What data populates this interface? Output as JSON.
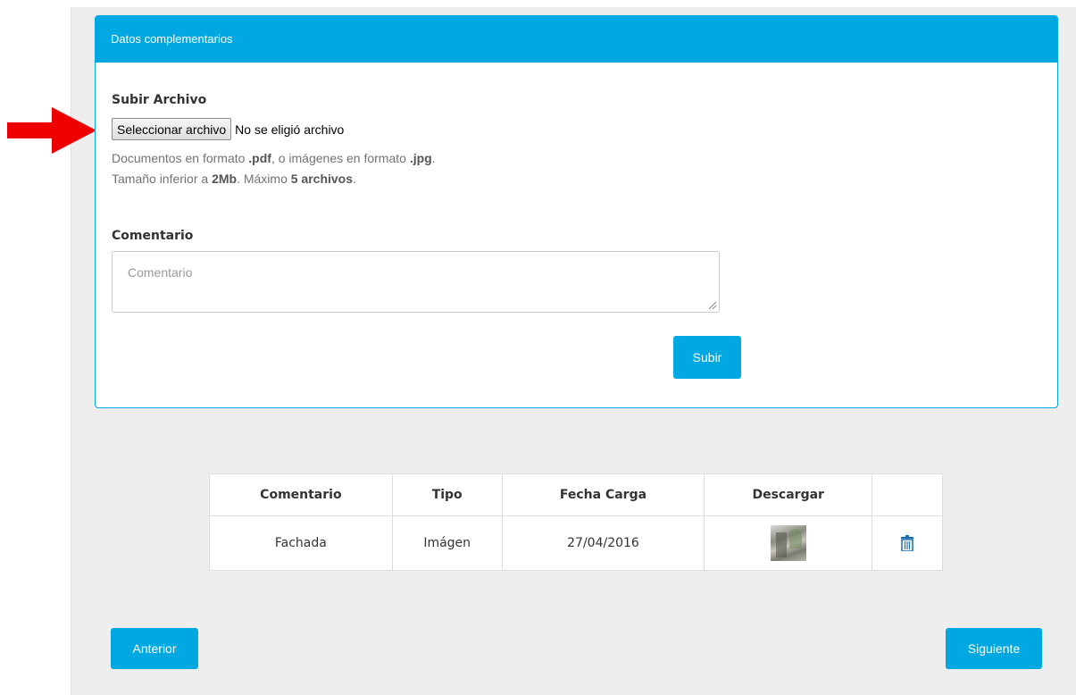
{
  "panel": {
    "title": "Datos complementarios"
  },
  "upload": {
    "label": "Subir Archivo",
    "choose_button": "Seleccionar archivo",
    "no_file_text": "No se eligió archivo",
    "help_line1": {
      "prefix": "Documentos en formato ",
      "fmt1": ".pdf",
      "middle": ", o imágenes en formato ",
      "fmt2": ".jpg",
      "suffix": "."
    },
    "help_line2": {
      "prefix": "Tamaño inferior a ",
      "size": "2Mb",
      "middle": ". Máximo ",
      "max": "5 archivos",
      "suffix": "."
    }
  },
  "comment": {
    "label": "Comentario",
    "placeholder": "Comentario"
  },
  "submit_label": "Subir",
  "table": {
    "headers": [
      "Comentario",
      "Tipo",
      "Fecha Carga",
      "Descargar",
      ""
    ],
    "rows": [
      {
        "comentario": "Fachada",
        "tipo": "Imágen",
        "fecha": "27/04/2016"
      }
    ]
  },
  "nav": {
    "prev_label": "Anterior",
    "next_label": "Siguiente"
  },
  "icons": {
    "arrow": "right-arrow-icon",
    "thumbnail": "image-thumbnail",
    "delete": "trash-icon",
    "resize": "resize-grip-icon"
  },
  "colors": {
    "accent": "#00a8e1",
    "arrow": "#ee0000",
    "trash": "#1b6fb3",
    "background": "#eeeeee"
  }
}
